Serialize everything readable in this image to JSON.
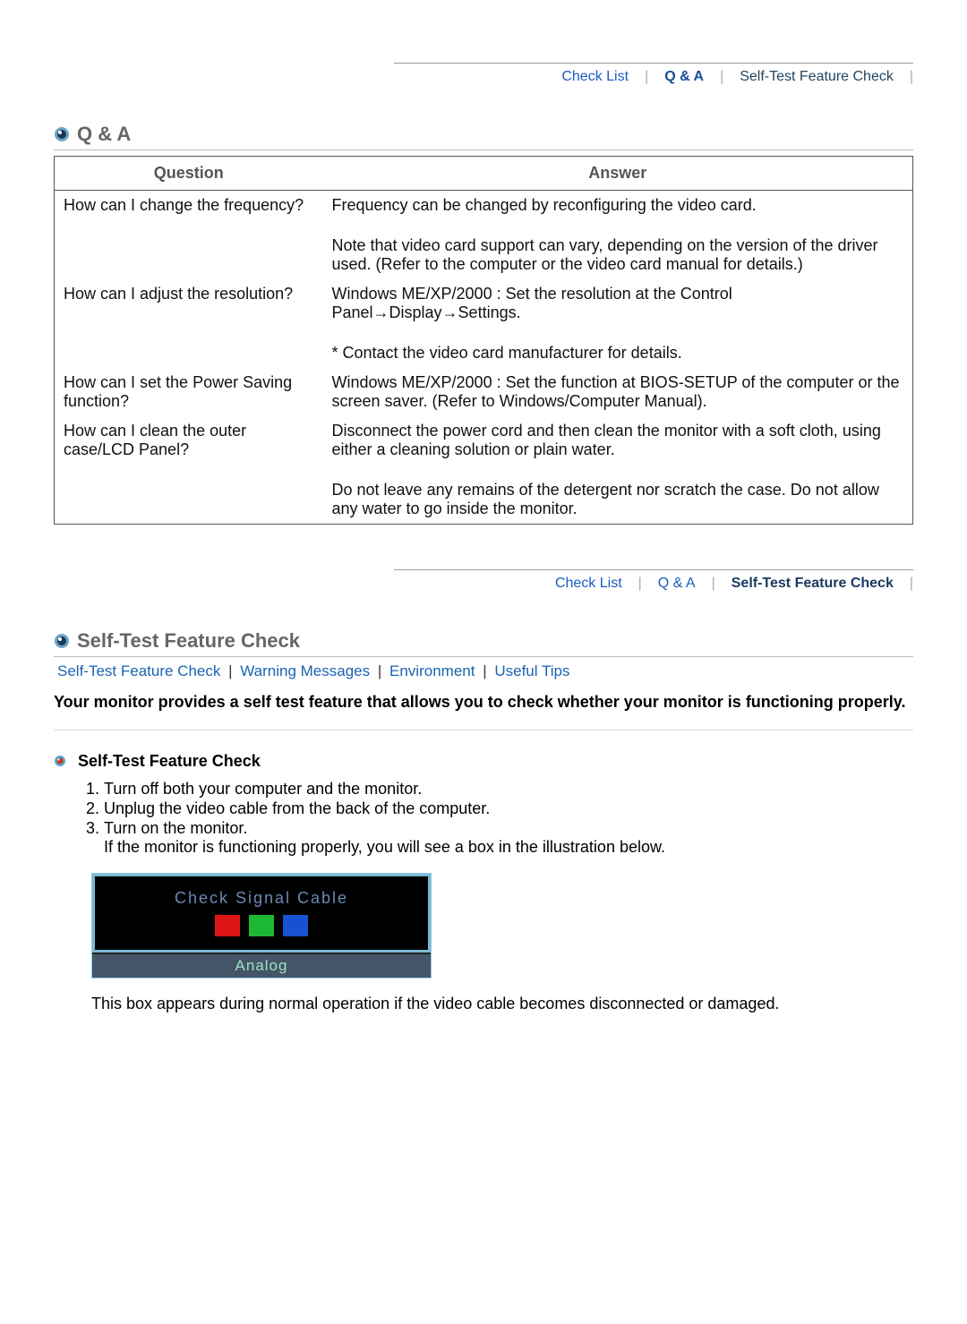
{
  "tabs1": {
    "check_list": "Check List",
    "qa": "Q & A",
    "selftest": "Self-Test Feature Check"
  },
  "tabs2": {
    "check_list": "Check List",
    "qa": "Q & A",
    "selftest": "Self-Test Feature Check"
  },
  "qa_section": {
    "title": "Q & A",
    "head_q": "Question",
    "head_a": "Answer",
    "rows": [
      {
        "q": "How can I change the frequency?",
        "a1": "Frequency can be changed by reconfiguring the video card.",
        "a2": "Note that video card support can vary, depending on the version of the driver used. (Refer to the computer or the video card manual for details.)"
      },
      {
        "q": "How can I adjust the resolution?",
        "a1": "Windows ME/XP/2000 : Set the resolution at the Control Panel→Display→Settings.",
        "a2": "* Contact the video card manufacturer for details."
      },
      {
        "q": "How can I set the Power Saving function?",
        "a1": "Windows ME/XP/2000 : Set the function at BIOS-SETUP of the computer or the screen saver. (Refer to Windows/Computer Manual)."
      },
      {
        "q": "How can I clean the outer case/LCD Panel?",
        "a1": "Disconnect the power cord and then clean the monitor with a soft cloth, using either a cleaning solution or plain water.",
        "a2": "Do not leave any remains of the detergent nor scratch the case. Do not allow any water to go inside the monitor."
      }
    ]
  },
  "selftest_section": {
    "title": "Self-Test Feature Check",
    "sublinks": {
      "a": "Self-Test Feature Check",
      "b": "Warning Messages",
      "c": "Environment",
      "d": "Useful Tips"
    },
    "intro": "Your monitor provides a self test feature that allows you to check whether your monitor is functioning properly.",
    "subheading": "Self-Test Feature Check",
    "steps": {
      "s1": "Turn off both your computer and the monitor.",
      "s2": "Unplug the video cable from the back of the computer.",
      "s3": "Turn on the monitor.",
      "s3b": "If the monitor is functioning properly, you will see a box in the illustration below."
    },
    "illustration": {
      "msg": "Check Signal Cable",
      "mode": "Analog"
    },
    "after": "This box appears during normal operation if the video cable becomes disconnected or damaged."
  }
}
